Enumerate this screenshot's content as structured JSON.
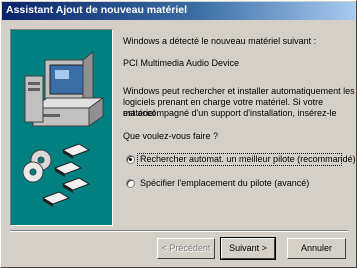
{
  "window": {
    "title": "Assistant Ajout de nouveau matériel"
  },
  "content": {
    "detected_text": "Windows a détecté le nouveau matériel suivant :",
    "device_name": "PCI Multimedia Audio Device",
    "info_lines": [
      "Windows peut rechercher et installer automatiquement les",
      "logiciels prenant en charge votre matériel. Si votre matériel",
      "est accompagné d'un support d'installation, insérez-le"
    ],
    "question": "Que voulez-vous faire ?",
    "options": [
      {
        "label": "Rechercher automat. un meilleur pilote (recommandé)",
        "selected": true
      },
      {
        "label": "Spécifier l'emplacement du pilote (avancé)",
        "selected": false
      }
    ]
  },
  "buttons": {
    "back": "< Précédent",
    "next": "Suivant >",
    "cancel": "Annuler"
  },
  "colors": {
    "art_background": "#008080",
    "title_start": "#0a246a"
  }
}
